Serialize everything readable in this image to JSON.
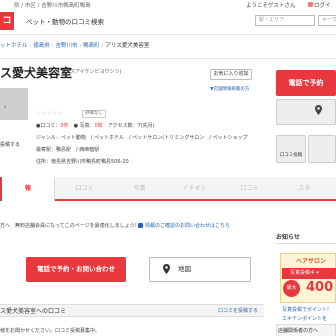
{
  "header": {
    "region": "県 / 市区 / 吉野川市鴨島町鴨島",
    "welcome": "ようこそゲストさん",
    "login": "ログイ",
    "logo": "コ",
    "site_title": "ペット・動物の口コミ検索",
    "area_placeholder": "駅・エリア",
    "keyword_placeholder": "キーワ"
  },
  "breadcrumb": [
    "ットホテル",
    "徳島県",
    "吉野川市",
    "鴨島町",
    "アリス愛犬美容室"
  ],
  "shop": {
    "name": "ス愛犬美容室",
    "kana": "(アリスアイケンビヨウシツ)",
    "fav_button": "お気に入り追加",
    "listing_note": "▼店舗情報掲載の方",
    "post_label": "投稿する",
    "photo_label": "s",
    "stars": "☆☆☆☆☆",
    "unrated": "評価なし",
    "stats": [
      "●口コミ：",
      "0件",
      "　● 写真：",
      "0枚",
      "　アクセス数：",
      "7(先月)"
    ],
    "genre": "ジャンル：ペット動物　/ ペットホテル　/ ペットサロン(トリミングサロン　/ ペットショップ",
    "station": "最寄駅：鴨島駅　/ 西麻植駅",
    "address": "住所：徳島県吉野川市鴨島町鴨島506-20"
  },
  "right_actions": {
    "call_label": "電話で予約",
    "post_label": "口コミ投稿"
  },
  "tabs": [
    "報",
    "口コミ",
    "写真",
    "イチオシ",
    "口コミ",
    "スタ"
  ],
  "notice": {
    "text": "方へ　無料店舗会員になってこのページを最適化しましょう！",
    "link": "情報のご確認のお問い合わせはこちら"
  },
  "cta": {
    "call": "電話で予約・お問い合わせ",
    "map": "地図"
  },
  "section": {
    "title": "ス愛犬美容室への口コミ",
    "link": "口コミを投稿する",
    "body": "様をお聞かせください。口コミ投稿募集中。"
  },
  "sidebar": {
    "notice_head": "お知らせ",
    "banner_top": "ヘアサロン",
    "banner_mid": "写真投稿キャ",
    "banner_big": "400",
    "banner_circle": "最大",
    "links": [
      "写真投稿でポイント!",
      "エキテンポイントを"
    ],
    "section_head": "店舗関係者の方へ"
  }
}
